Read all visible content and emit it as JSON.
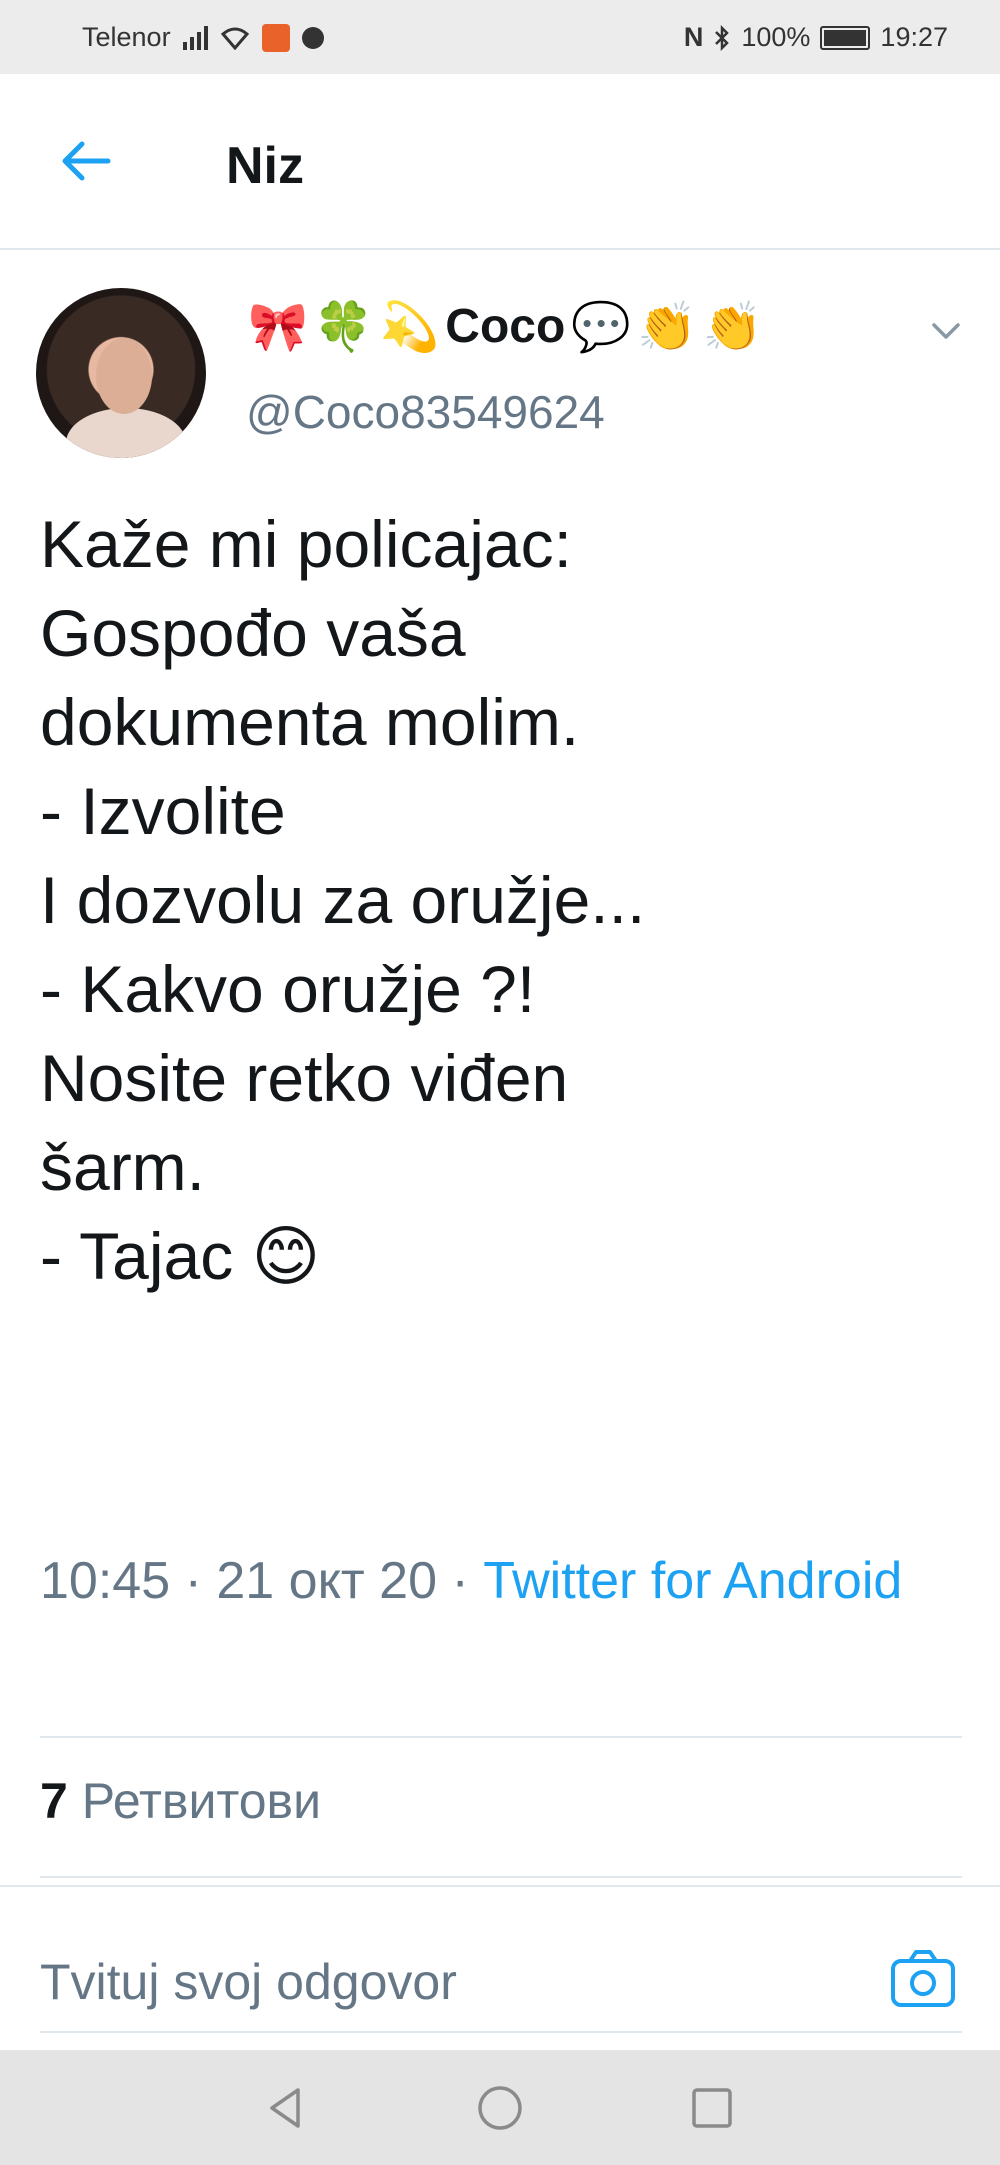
{
  "status_bar": {
    "carrier": "Telenor",
    "battery": "100%",
    "time": "19:27",
    "nfc_label": "N"
  },
  "header": {
    "title": "Niz",
    "back_icon": "arrow-left-icon"
  },
  "tweet": {
    "display_name": "Coco",
    "name_emojis_before": [
      "🎀",
      "🍀",
      "💫"
    ],
    "name_emojis_after": [
      "💬",
      "👏",
      "👏"
    ],
    "handle": "@Coco83549624",
    "text_lines": [
      "Kaže mi policajac:",
      "Gospođo vaša",
      "dokumenta molim.",
      "- Izvolite",
      "I dozvolu za oružje...",
      "- Kakvo oružje ?!",
      "Nosite retko viđen",
      "šarm.",
      "- Tajac"
    ],
    "trailing_emoji": "😊",
    "time": "10:45",
    "separator": " · ",
    "date": "21 окт 20",
    "source": "Twitter for Android",
    "retweet_count": "7",
    "retweet_label": "Ретвитови"
  },
  "reply": {
    "placeholder": "Tvituj svoj odgovor",
    "camera_icon": "camera-icon"
  },
  "colors": {
    "accent": "#1da1f2",
    "text": "#14171a",
    "secondary": "#657786",
    "divider": "#e1e8ed"
  }
}
